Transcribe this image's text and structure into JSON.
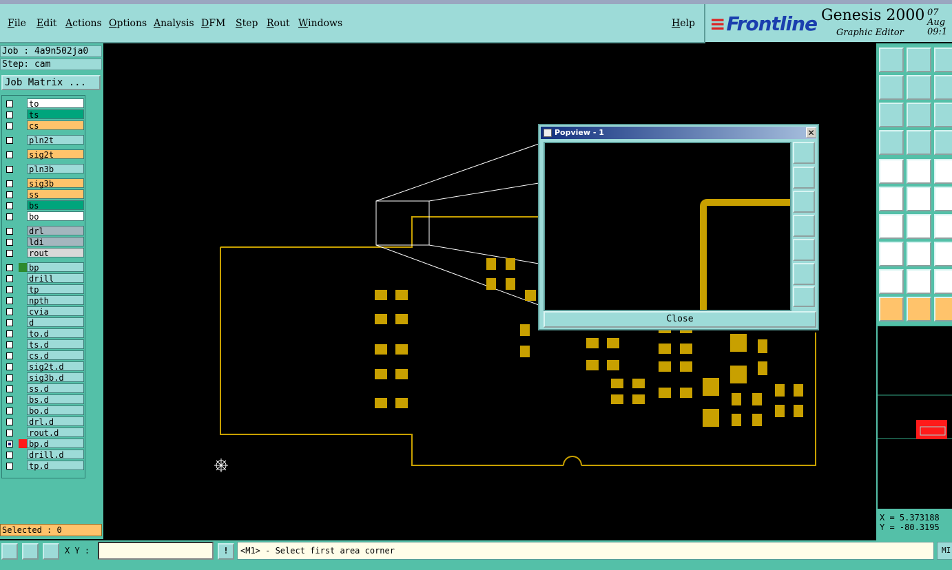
{
  "menubar": {
    "items": [
      "File",
      "Edit",
      "Actions",
      "Options",
      "Analysis",
      "DFM",
      "Step",
      "Rout",
      "Windows"
    ],
    "help": "Help"
  },
  "brand": {
    "logo": "Frontline",
    "product": "Genesis 2000",
    "subtitle": "Graphic Editor",
    "date_line1": "07 Aug",
    "date_line2": "09:1"
  },
  "job": {
    "job_label": "Job : 4a9n502ja0",
    "step_label": "Step: cam",
    "matrix_button": "Job Matrix ..."
  },
  "layers": [
    {
      "name": "to",
      "color": "#ffffff",
      "sw": ""
    },
    {
      "name": "ts",
      "color": "#00a57c",
      "sw": ""
    },
    {
      "name": "cs",
      "color": "#ffc36b",
      "sw": ""
    },
    {
      "name": "pln2t",
      "color": "#9ddbd8",
      "sw": ""
    },
    {
      "name": "sig2t",
      "color": "#ffc36b",
      "sw": ""
    },
    {
      "name": "pln3b",
      "color": "#9ddbd8",
      "sw": ""
    },
    {
      "name": "sig3b",
      "color": "#ffc36b",
      "sw": ""
    },
    {
      "name": "ss",
      "color": "#ffc36b",
      "sw": ""
    },
    {
      "name": "bs",
      "color": "#00a57c",
      "sw": ""
    },
    {
      "name": "bo",
      "color": "#ffffff",
      "sw": ""
    },
    {
      "name": "drl",
      "color": "#a4b6be",
      "sw": ""
    },
    {
      "name": "ldi",
      "color": "#a4b6be",
      "sw": ""
    },
    {
      "name": "rout",
      "color": "#d8d8d8",
      "sw": ""
    },
    {
      "name": "bp",
      "color": "#9ddbd8",
      "sw": "#2d8a2d"
    },
    {
      "name": "drill",
      "color": "#9ddbd8",
      "sw": ""
    },
    {
      "name": "tp",
      "color": "#9ddbd8",
      "sw": ""
    },
    {
      "name": "npth",
      "color": "#9ddbd8",
      "sw": ""
    },
    {
      "name": "cvia",
      "color": "#9ddbd8",
      "sw": ""
    },
    {
      "name": "d",
      "color": "#9ddbd8",
      "sw": ""
    },
    {
      "name": "to.d",
      "color": "#9ddbd8",
      "sw": ""
    },
    {
      "name": "ts.d",
      "color": "#9ddbd8",
      "sw": ""
    },
    {
      "name": "cs.d",
      "color": "#9ddbd8",
      "sw": ""
    },
    {
      "name": "sig2t.d",
      "color": "#9ddbd8",
      "sw": ""
    },
    {
      "name": "sig3b.d",
      "color": "#9ddbd8",
      "sw": ""
    },
    {
      "name": "ss.d",
      "color": "#9ddbd8",
      "sw": ""
    },
    {
      "name": "bs.d",
      "color": "#9ddbd8",
      "sw": ""
    },
    {
      "name": "bo.d",
      "color": "#9ddbd8",
      "sw": ""
    },
    {
      "name": "drl.d",
      "color": "#9ddbd8",
      "sw": ""
    },
    {
      "name": "rout.d",
      "color": "#9ddbd8",
      "sw": ""
    },
    {
      "name": "bp.d",
      "color": "#9ddbd8",
      "sw": "#ff1a1a",
      "active": true
    },
    {
      "name": "drill.d",
      "color": "#9ddbd8",
      "sw": ""
    },
    {
      "name": "tp.d",
      "color": "#9ddbd8",
      "sw": ""
    }
  ],
  "status": {
    "selected": "Selected : 0",
    "xy_label": "X Y :",
    "xy_value": "",
    "message": "<M1> - Select first area corner",
    "mouse_button": "MI"
  },
  "coords": {
    "x": "X = 5.373188",
    "y": "Y = -80.3195"
  },
  "popview": {
    "title": "Popview - 1",
    "close_label": "Close"
  },
  "colors": {
    "panel": "#9ddbd8",
    "panel_dark": "#54c0a8",
    "board_feature": "#c8a000",
    "highlight": "#ffc36b"
  }
}
